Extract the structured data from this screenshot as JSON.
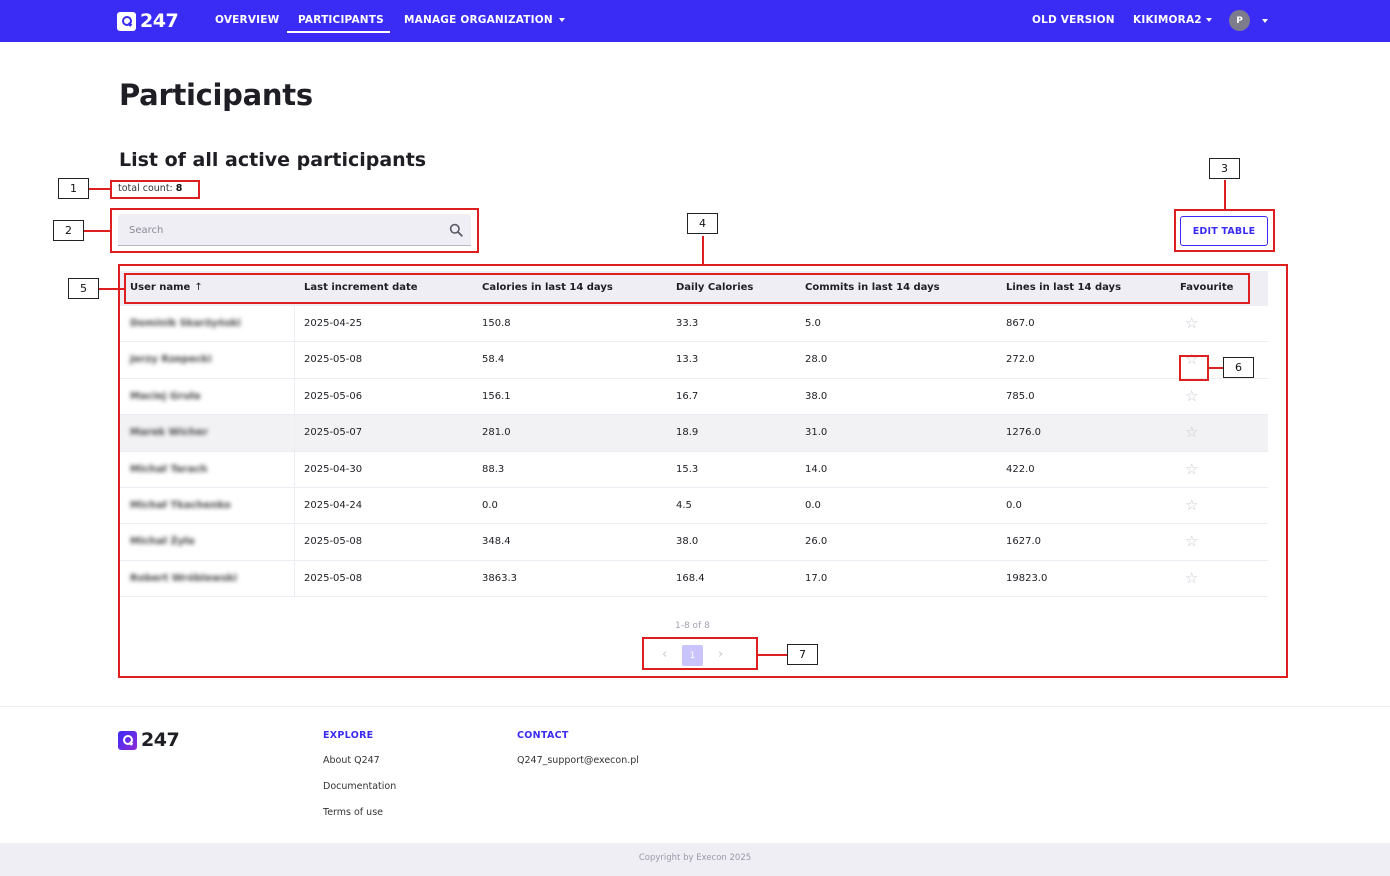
{
  "nav": {
    "logo_text": "247",
    "items": [
      {
        "label": "OVERVIEW"
      },
      {
        "label": "PARTICIPANTS"
      },
      {
        "label": "MANAGE ORGANIZATION"
      }
    ],
    "active_item": "PARTICIPANTS",
    "old_version": "OLD VERSION",
    "user_menu": "KIKIMORA2",
    "avatar_initial": "P"
  },
  "page": {
    "title": "Participants",
    "section_title": "List of all active participants",
    "total_count_label": "total count:",
    "total_count_value": "8"
  },
  "search": {
    "placeholder": "Search",
    "value": ""
  },
  "edit_table_label": "EDIT TABLE",
  "table": {
    "columns": [
      "User name",
      "Last increment date",
      "Calories in last 14 days",
      "Daily Calories",
      "Commits in last 14 days",
      "Lines in last 14 days",
      "Favourite"
    ],
    "sort_column": "User name",
    "sort_arrow": "↑",
    "rows": [
      {
        "name": "Dominik Skarżyński",
        "date": "2025-04-25",
        "calories": "150.8",
        "daily": "33.3",
        "commits": "5.0",
        "lines": "867.0",
        "favourite": false
      },
      {
        "name": "Jerzy Rzepecki",
        "date": "2025-05-08",
        "calories": "58.4",
        "daily": "13.3",
        "commits": "28.0",
        "lines": "272.0",
        "favourite": false
      },
      {
        "name": "Maciej Gruła",
        "date": "2025-05-06",
        "calories": "156.1",
        "daily": "16.7",
        "commits": "38.0",
        "lines": "785.0",
        "favourite": false
      },
      {
        "name": "Marek Wicher",
        "date": "2025-05-07",
        "calories": "281.0",
        "daily": "18.9",
        "commits": "31.0",
        "lines": "1276.0",
        "favourite": false
      },
      {
        "name": "Michał Tarach",
        "date": "2025-04-30",
        "calories": "88.3",
        "daily": "15.3",
        "commits": "14.0",
        "lines": "422.0",
        "favourite": false
      },
      {
        "name": "Michał Tkachenko",
        "date": "2025-04-24",
        "calories": "0.0",
        "daily": "4.5",
        "commits": "0.0",
        "lines": "0.0",
        "favourite": false
      },
      {
        "name": "Michał Żyła",
        "date": "2025-05-08",
        "calories": "348.4",
        "daily": "38.0",
        "commits": "26.0",
        "lines": "1627.0",
        "favourite": false
      },
      {
        "name": "Robert Wróblewski",
        "date": "2025-05-08",
        "calories": "3863.3",
        "daily": "168.4",
        "commits": "17.0",
        "lines": "19823.0",
        "favourite": false
      }
    ],
    "highlighted_row": 3
  },
  "pagination": {
    "range": "1-8 of 8",
    "current_page": "1",
    "prev": "‹",
    "next": "›"
  },
  "annotations": [
    "1",
    "2",
    "3",
    "4",
    "5",
    "6",
    "7"
  ],
  "footer": {
    "explore_heading": "EXPLORE",
    "explore_links": [
      "About Q247",
      "Documentation",
      "Terms of use"
    ],
    "contact_heading": "CONTACT",
    "contact_email": "Q247_support@execon.pl",
    "copyright": "Copyright by Execon 2025"
  },
  "colors": {
    "brand": "#3b2cf5",
    "annotation": "#dd1f1f",
    "header_bg": "#eeeef4"
  }
}
